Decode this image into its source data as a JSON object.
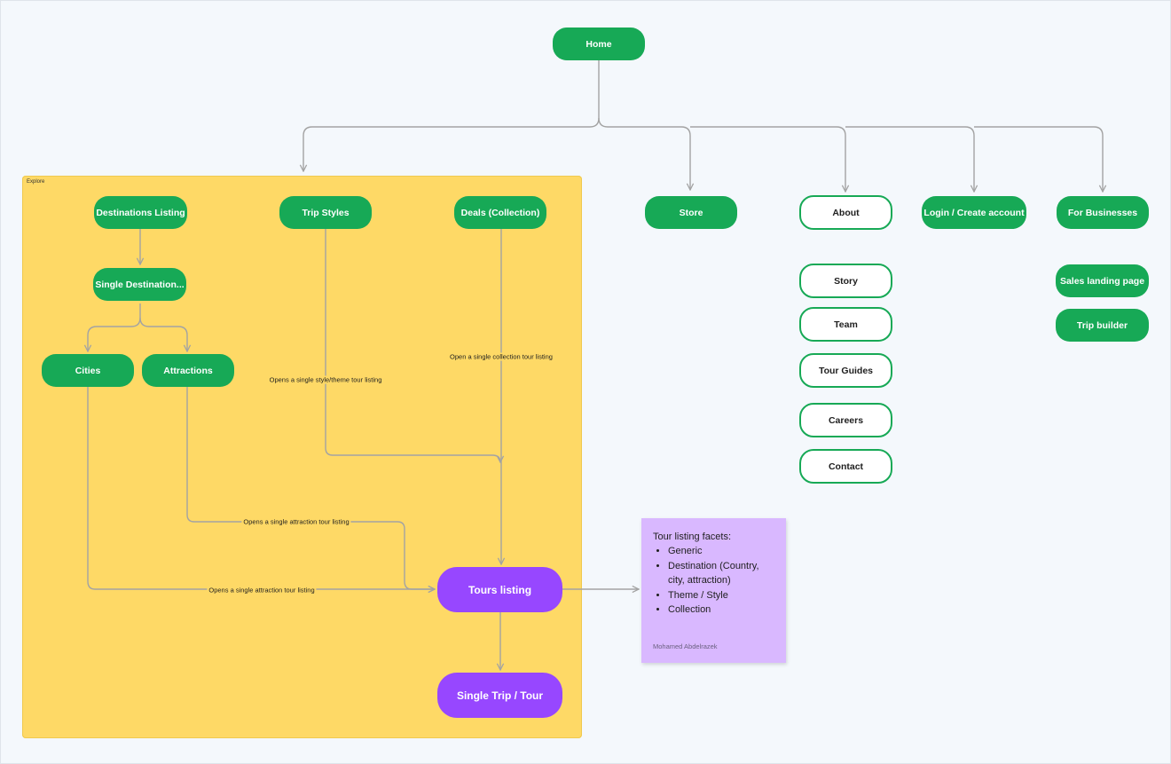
{
  "section": {
    "label": "Explore"
  },
  "nodes": {
    "home": "Home",
    "destinations_listing": "Destinations Listing",
    "trip_styles": "Trip Styles",
    "deals": "Deals (Collection)",
    "single_destination": "Single Destination...",
    "cities": "Cities",
    "attractions": "Attractions",
    "tours_listing": "Tours listing",
    "single_trip": "Single Trip / Tour",
    "store": "Store",
    "about": "About",
    "login": "Login / Create account",
    "for_businesses": "For Businesses",
    "story": "Story",
    "team": "Team",
    "tour_guides": "Tour Guides",
    "careers": "Careers",
    "contact": "Contact",
    "sales_landing": "Sales landing page",
    "trip_builder": "Trip builder"
  },
  "edge_labels": {
    "style": "Opens a single style/theme tour listing",
    "collection": "Open a single collection tour listing",
    "attraction": "Opens a single attraction tour listing",
    "city": "Opens a single attraction tour listing"
  },
  "sticky": {
    "title": "Tour listing facets:",
    "items": [
      "Generic",
      "Destination (Country, city, attraction)",
      "Theme / Style",
      "Collection"
    ],
    "author": "Mohamed Abdelrazek"
  },
  "colors": {
    "section": "#fed966",
    "node_green": "#17a956",
    "node_purple": "#9747ff",
    "sticky": "#d9b8ff",
    "connector": "#a3a3a3"
  }
}
